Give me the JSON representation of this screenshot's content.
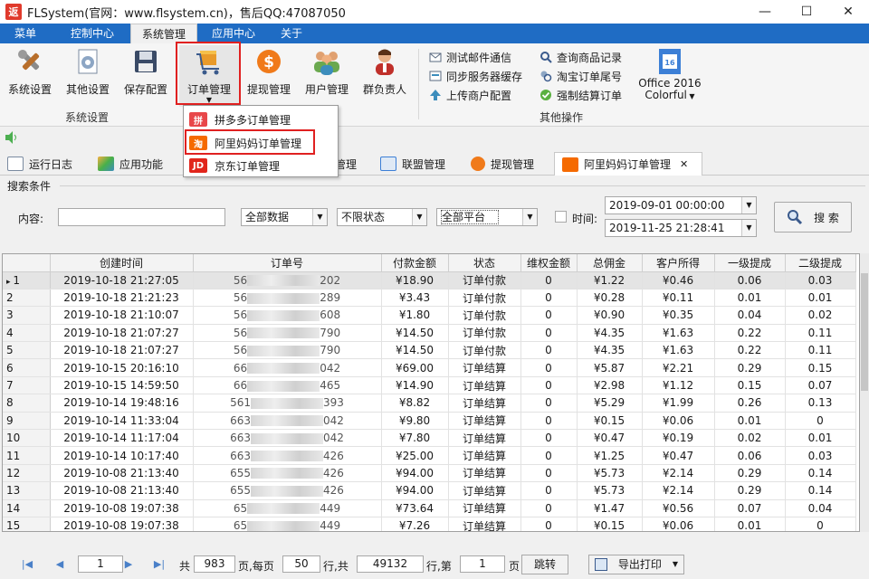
{
  "window": {
    "logo_text": "返",
    "title": "FLSystem(官网：www.flsystem.cn)，售后QQ:47087050",
    "min_glyph": "—",
    "max_glyph": "☐",
    "close_glyph": "✕"
  },
  "menu": [
    "菜单",
    "控制中心",
    "系统管理",
    "应用中心",
    "关于"
  ],
  "ribbon": {
    "buttons": [
      {
        "label": "系统设置",
        "icon": "tools-icon"
      },
      {
        "label": "其他设置",
        "icon": "settings-doc-icon"
      },
      {
        "label": "保存配置",
        "icon": "floppy-icon"
      },
      {
        "label": "订单管理",
        "icon": "cart-box-icon"
      },
      {
        "label": "提现管理",
        "icon": "dollar-icon"
      },
      {
        "label": "用户管理",
        "icon": "users-icon"
      },
      {
        "label": "群负责人",
        "icon": "person-icon"
      }
    ],
    "group_system": "系统设置",
    "group_other": "其他操作",
    "small_items": [
      "测试邮件通信",
      "同步服务器缓存",
      "上传商户配置",
      "查询商品记录",
      "淘宝订单尾号",
      "强制结算订单"
    ],
    "office_label1": "Office 2016",
    "office_label2": "Colorful"
  },
  "dropdown": {
    "items": [
      {
        "label": "拼多多订单管理",
        "icon_text": "拼",
        "color": "#e8474a"
      },
      {
        "label": "阿里妈妈订单管理",
        "icon_text": "淘",
        "color": "#f56a00"
      },
      {
        "label": "京东订单管理",
        "icon_text": "JD",
        "color": "#e1251b"
      }
    ]
  },
  "tabs": [
    {
      "label": "运行日志"
    },
    {
      "label": "应用功能"
    },
    {
      "label": "管理"
    },
    {
      "label": "联盟管理"
    },
    {
      "label": "提现管理"
    },
    {
      "label": "阿里妈妈订单管理",
      "close": "✕"
    }
  ],
  "search": {
    "title": "搜索条件",
    "content_label": "内容:",
    "content_value": "",
    "data_select": "全部数据",
    "status_select": "不限状态",
    "platform_select": "全部平台",
    "time_label": "时间:",
    "start_time": "2019-09-01 00:00:00",
    "end_time": "2019-11-25 21:28:41",
    "search_button": "搜 索"
  },
  "table": {
    "columns": [
      "",
      "创建时间",
      "订单号",
      "付款金额",
      "状态",
      "维权金额",
      "总佣金",
      "客户所得",
      "一级提成",
      "二级提成"
    ],
    "rows": [
      [
        "1",
        "2019-10-18 21:27:05",
        "56",
        "202",
        "¥18.90",
        "订单付款",
        "0",
        "¥1.22",
        "¥0.46",
        "0.06",
        "0.03"
      ],
      [
        "2",
        "2019-10-18 21:21:23",
        "56",
        "289",
        "¥3.43",
        "订单付款",
        "0",
        "¥0.28",
        "¥0.11",
        "0.01",
        "0.01"
      ],
      [
        "3",
        "2019-10-18 21:10:07",
        "56",
        "608",
        "¥1.80",
        "订单付款",
        "0",
        "¥0.90",
        "¥0.35",
        "0.04",
        "0.02"
      ],
      [
        "4",
        "2019-10-18 21:07:27",
        "56",
        "790",
        "¥14.50",
        "订单付款",
        "0",
        "¥4.35",
        "¥1.63",
        "0.22",
        "0.11"
      ],
      [
        "5",
        "2019-10-18 21:07:27",
        "56",
        "790",
        "¥14.50",
        "订单付款",
        "0",
        "¥4.35",
        "¥1.63",
        "0.22",
        "0.11"
      ],
      [
        "6",
        "2019-10-15 20:16:10",
        "66",
        "042",
        "¥69.00",
        "订单结算",
        "0",
        "¥5.87",
        "¥2.21",
        "0.29",
        "0.15"
      ],
      [
        "7",
        "2019-10-15 14:59:50",
        "66",
        "465",
        "¥14.90",
        "订单结算",
        "0",
        "¥2.98",
        "¥1.12",
        "0.15",
        "0.07"
      ],
      [
        "8",
        "2019-10-14 19:48:16",
        "561",
        "393",
        "¥8.82",
        "订单结算",
        "0",
        "¥5.29",
        "¥1.99",
        "0.26",
        "0.13"
      ],
      [
        "9",
        "2019-10-14 11:33:04",
        "663",
        "042",
        "¥9.80",
        "订单结算",
        "0",
        "¥0.15",
        "¥0.06",
        "0.01",
        "0"
      ],
      [
        "10",
        "2019-10-14 11:17:04",
        "663",
        "042",
        "¥7.80",
        "订单结算",
        "0",
        "¥0.47",
        "¥0.19",
        "0.02",
        "0.01"
      ],
      [
        "11",
        "2019-10-14 10:17:40",
        "663",
        "426",
        "¥25.00",
        "订单结算",
        "0",
        "¥1.25",
        "¥0.47",
        "0.06",
        "0.03"
      ],
      [
        "12",
        "2019-10-08 21:13:40",
        "655",
        "426",
        "¥94.00",
        "订单结算",
        "0",
        "¥5.73",
        "¥2.14",
        "0.29",
        "0.14"
      ],
      [
        "13",
        "2019-10-08 21:13:40",
        "655",
        "426",
        "¥94.00",
        "订单结算",
        "0",
        "¥5.73",
        "¥2.14",
        "0.29",
        "0.14"
      ],
      [
        "14",
        "2019-10-08 19:07:38",
        "65",
        "449",
        "¥73.64",
        "订单结算",
        "0",
        "¥1.47",
        "¥0.56",
        "0.07",
        "0.04"
      ],
      [
        "15",
        "2019-10-08 19:07:38",
        "65",
        "449",
        "¥7.26",
        "订单结算",
        "0",
        "¥0.15",
        "¥0.06",
        "0.01",
        "0"
      ]
    ]
  },
  "pager": {
    "current_page": "1",
    "total_label": "共",
    "total_pages": "983",
    "per_page_label": "页,每页",
    "per_page": "50",
    "rows_label": "行,共",
    "total_rows": "49132",
    "goto_label": "行,第",
    "goto_page": "1",
    "page_label": "页",
    "jump_button": "跳转",
    "export_button": "导出打印"
  }
}
